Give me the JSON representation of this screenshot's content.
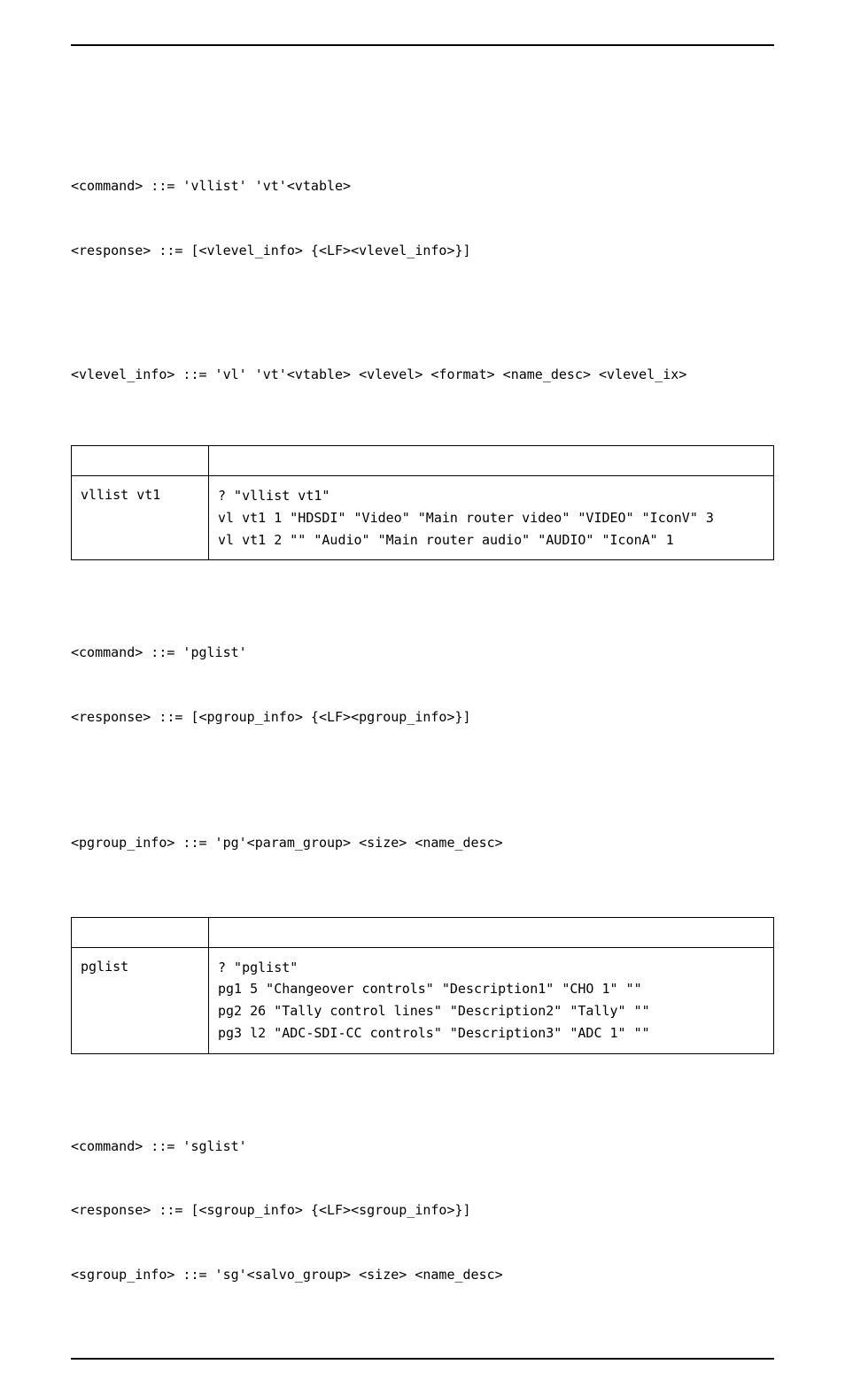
{
  "sections": [
    {
      "defs": [
        "<command> ::= 'vllist' 'vt'<vtable>",
        "<response> ::= [<vlevel_info> {<LF><vlevel_info>}]",
        "",
        "<vlevel_info> ::= 'vl' 'vt'<vtable> <vlevel> <format> <name_desc> <vlevel_ix>"
      ],
      "example": {
        "cmd": "vllist vt1",
        "resp": [
          "? \"vllist vt1\"",
          "vl vt1 1 \"HDSDI\" \"Video\" \"Main router video\" \"VIDEO\" \"IconV\" 3",
          "vl vt1 2 \"\" \"Audio\" \"Main router audio\" \"AUDIO\" \"IconA\" 1"
        ]
      }
    },
    {
      "defs": [
        "<command> ::= 'pglist'",
        "<response> ::= [<pgroup_info> {<LF><pgroup_info>}]",
        "",
        "<pgroup_info> ::= 'pg'<param_group> <size> <name_desc>"
      ],
      "example": {
        "cmd": "pglist",
        "resp": [
          "? \"pglist\"",
          "pg1 5 \"Changeover controls\" \"Description1\" \"CHO 1\" \"\"",
          "pg2 26 \"Tally control lines\" \"Description2\" \"Tally\" \"\"",
          "pg3 l2 \"ADC-SDI-CC controls\" \"Description3\" \"ADC 1\" \"\""
        ]
      }
    },
    {
      "defs": [
        "<command> ::= 'sglist'",
        "<response> ::= [<sgroup_info> {<LF><sgroup_info>}]",
        "<sgroup_info> ::= 'sg'<salvo_group> <size> <name_desc>"
      ]
    }
  ]
}
